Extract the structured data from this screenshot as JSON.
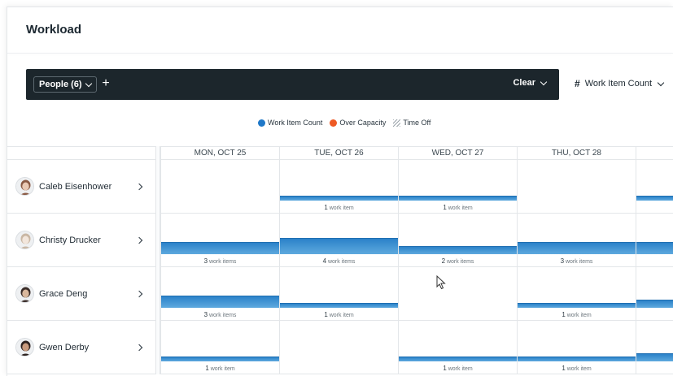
{
  "page": {
    "title": "Workload"
  },
  "filter_bar": {
    "people_chip": "People (6)",
    "add_icon": "+",
    "clear_label": "Clear"
  },
  "metric": {
    "hash": "#",
    "label": "Work Item Count"
  },
  "legend": [
    {
      "label": "Work Item Count",
      "color": "#1f78c8",
      "kind": "dot"
    },
    {
      "label": "Over Capacity",
      "color": "#ee5a24",
      "kind": "dot"
    },
    {
      "label": "Time Off",
      "color": "#9aa3aa",
      "kind": "hatch"
    }
  ],
  "days": [
    "MON, OCT 25",
    "TUE, OCT 26",
    "WED, OCT 27",
    "THU, OCT 28",
    ""
  ],
  "people": [
    {
      "name": "Caleb Eisenhower",
      "cells": [
        {
          "count": 0,
          "label": ""
        },
        {
          "count": 1,
          "label": "work item"
        },
        {
          "count": 1,
          "label": "work item"
        },
        {
          "count": 0,
          "label": ""
        },
        {
          "count": 1,
          "label": ""
        }
      ]
    },
    {
      "name": "Christy Drucker",
      "cells": [
        {
          "count": 3,
          "label": "work items"
        },
        {
          "count": 4,
          "label": "work items"
        },
        {
          "count": 2,
          "label": "work items"
        },
        {
          "count": 3,
          "label": "work items"
        },
        {
          "count": 3,
          "label": ""
        }
      ]
    },
    {
      "name": "Grace Deng",
      "cells": [
        {
          "count": 3,
          "label": "work items"
        },
        {
          "count": 1,
          "label": "work item"
        },
        {
          "count": 0,
          "label": ""
        },
        {
          "count": 1,
          "label": "work item"
        },
        {
          "count": 2,
          "label": ""
        }
      ]
    },
    {
      "name": "Gwen Derby",
      "cells": [
        {
          "count": 1,
          "label": "work item"
        },
        {
          "count": 0,
          "label": ""
        },
        {
          "count": 1,
          "label": "work item"
        },
        {
          "count": 1,
          "label": "work item"
        },
        {
          "count": 2,
          "label": ""
        }
      ]
    }
  ]
}
